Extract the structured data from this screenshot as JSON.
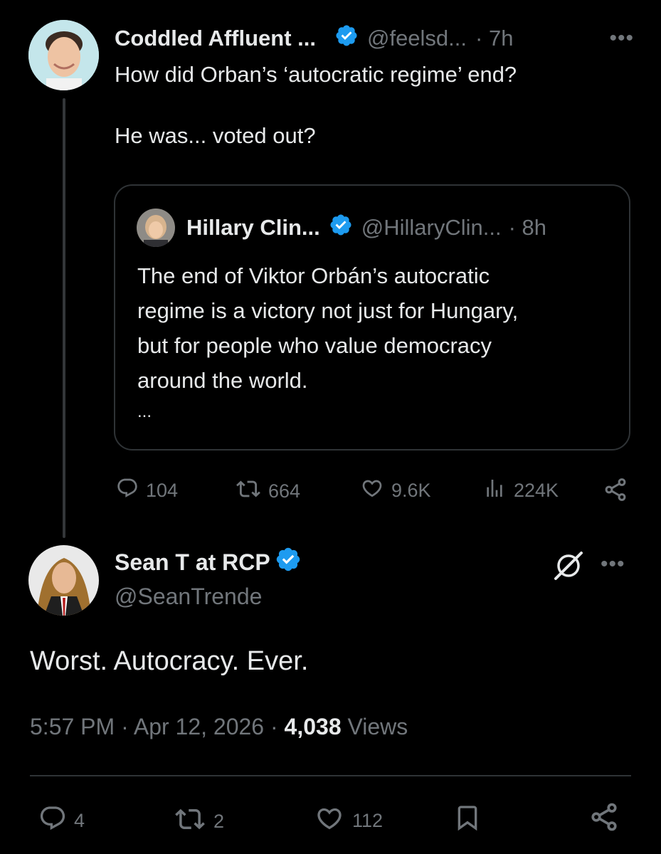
{
  "parent_post": {
    "author_name": "Coddled Affluent ...",
    "handle": "@feelsd...",
    "time": "· 7h",
    "text_line1": "How did Orban’s ‘autocratic regime’ end?",
    "text_line2": "He was... voted out?",
    "quoted": {
      "author_name": "Hillary Clin...",
      "handle": "@HillaryClin...",
      "time": "· 8h",
      "text_lines": [
        "The end of Viktor Orbán’s autocratic",
        "regime is a victory not just for Hungary,",
        "but for people who value democracy",
        "around the world."
      ],
      "more": "..."
    },
    "actions": {
      "replies": "104",
      "reposts": "664",
      "likes": "9.6K",
      "views": "224K"
    }
  },
  "main_post": {
    "author_name": "Sean T at RCP",
    "handle": "@SeanTrende",
    "text": "Worst. Autocracy. Ever.",
    "timestamp": "5:57 PM · Apr 12, 2026 · ",
    "views_count": "4,038",
    "views_label": " Views",
    "actions": {
      "replies": "4",
      "reposts": "2",
      "likes": "112"
    }
  },
  "colors": {
    "background": "#000000",
    "text": "#e7e9ea",
    "muted": "#71767b",
    "verified": "#1d9bf0",
    "border": "#2f3336"
  }
}
